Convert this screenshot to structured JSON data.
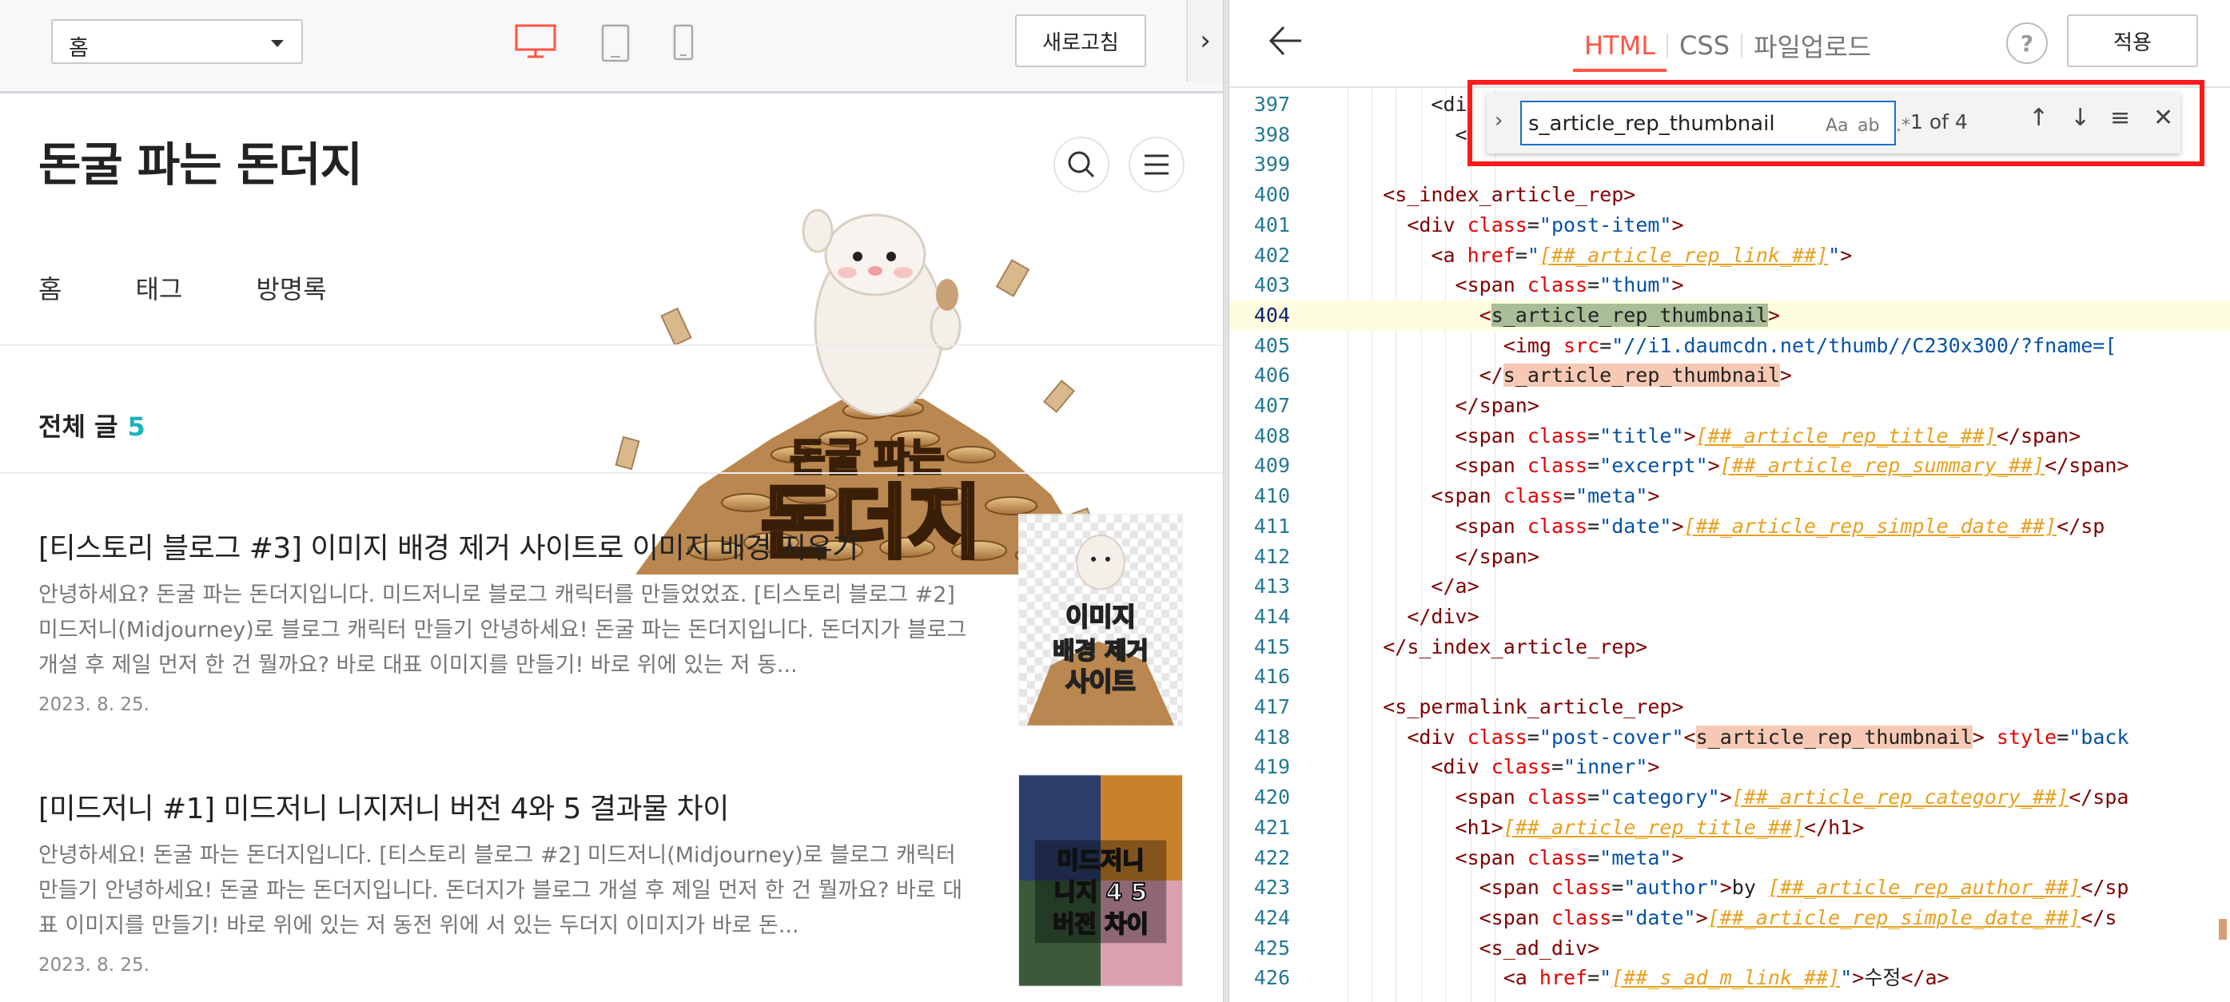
{
  "preview": {
    "page_select_value": "홈",
    "refresh_label": "새로고침",
    "collapse_glyph": "›",
    "devices": [
      "desktop",
      "tablet",
      "mobile"
    ]
  },
  "blog": {
    "title": "돈굴 파는 돈더지",
    "nav": [
      "홈",
      "태그",
      "방명록"
    ],
    "total_label": "전체 글",
    "total_count": "5",
    "mascot_line1": "돈굴 파는",
    "mascot_line2": "돈더지",
    "posts": [
      {
        "title": "[티스토리 블로그 #3] 이미지 배경 제거 사이트로 이미지 배경 지우기",
        "excerpt": "안녕하세요? 돈굴 파는 돈더지입니다. 미드저니로 블로그 캐릭터를 만들었었죠. [티스토리 블로그 #2] 미드저니(Midjourney)로 블로그 캐릭터 만들기 안녕하세요! 돈굴 파는 돈더지입니다. 돈더지가 블로그 개설 후 제일 먼저 한 건 뭘까요? 바로 대표 이미지를 만들기! 바로 위에 있는 저 동...",
        "date": "2023. 8. 25.",
        "thumb_text": [
          "이미지",
          "배경 제거",
          "사이트"
        ]
      },
      {
        "title": "[미드저니 #1] 미드저니 니지저니 버전 4와 5 결과물 차이",
        "excerpt": "안녕하세요! 돈굴 파는 돈더지입니다. [티스토리 블로그 #2] 미드저니(Midjourney)로 블로그 캐릭터 만들기 안녕하세요! 돈굴 파는 돈더지입니다. 돈더지가 블로그 개설 후 제일 먼저 한 건 뭘까요? 바로 대표 이미지를 만들기! 바로 위에 있는 저 동전 위에 서 있는 두더지 이미지가 바로 돈...",
        "date": "2023. 8. 25.",
        "thumb_text": [
          "미드저니",
          "니지 4 5",
          "버전 차이"
        ]
      }
    ]
  },
  "editor": {
    "tabs": [
      "HTML",
      "CSS",
      "파일업로드"
    ],
    "active_tab": "HTML",
    "help_label": "?",
    "apply_label": "적용",
    "find": {
      "query": "s_article_rep_thumbnail",
      "match_case": "Aa",
      "whole_word": "ab",
      "regex": ".*",
      "count": "1 of 4"
    },
    "lines": [
      {
        "n": "397",
        "segs": [
          [
            "t",
            "        <di"
          ]
        ]
      },
      {
        "n": "398",
        "segs": [
          [
            "t",
            "          <"
          ]
        ]
      },
      {
        "n": "399",
        "segs": [
          [
            "t",
            ""
          ]
        ]
      },
      {
        "n": "400",
        "segs": [
          [
            "t",
            "    "
          ],
          [
            "tag",
            "<s_index_article_rep>"
          ]
        ]
      },
      {
        "n": "401",
        "segs": [
          [
            "t",
            "      "
          ],
          [
            "tag",
            "<div"
          ],
          [
            "t",
            " "
          ],
          [
            "attr",
            "class"
          ],
          [
            "t",
            "="
          ],
          [
            "str",
            "\"post-item\""
          ],
          [
            "tag",
            ">"
          ]
        ]
      },
      {
        "n": "402",
        "segs": [
          [
            "t",
            "        "
          ],
          [
            "tag",
            "<a"
          ],
          [
            "t",
            " "
          ],
          [
            "attr",
            "href"
          ],
          [
            "t",
            "="
          ],
          [
            "str",
            "\""
          ],
          [
            "ph",
            "[##_article_rep_link_##]"
          ],
          [
            "str",
            "\""
          ],
          [
            "tag",
            ">"
          ]
        ]
      },
      {
        "n": "403",
        "segs": [
          [
            "t",
            "          "
          ],
          [
            "tag",
            "<span"
          ],
          [
            "t",
            " "
          ],
          [
            "attr",
            "class"
          ],
          [
            "t",
            "="
          ],
          [
            "str",
            "\"thum\""
          ],
          [
            "tag",
            ">"
          ]
        ]
      },
      {
        "n": "404",
        "segs": [
          [
            "t",
            "            "
          ],
          [
            "tag",
            "<"
          ],
          [
            "markcur",
            "s_article_rep_thumbnail"
          ],
          [
            "tag",
            ">"
          ]
        ],
        "current": true
      },
      {
        "n": "405",
        "segs": [
          [
            "t",
            "              "
          ],
          [
            "tag",
            "<img"
          ],
          [
            "t",
            " "
          ],
          [
            "attr",
            "src"
          ],
          [
            "t",
            "="
          ],
          [
            "str",
            "\"//i1.daumcdn.net/thumb//C230x300/?fname=["
          ]
        ]
      },
      {
        "n": "406",
        "segs": [
          [
            "t",
            "            "
          ],
          [
            "tag",
            "</"
          ],
          [
            "mark",
            "s_article_rep_thumbnail"
          ],
          [
            "tag",
            ">"
          ]
        ]
      },
      {
        "n": "407",
        "segs": [
          [
            "t",
            "          "
          ],
          [
            "tag",
            "</span>"
          ]
        ]
      },
      {
        "n": "408",
        "segs": [
          [
            "t",
            "          "
          ],
          [
            "tag",
            "<span"
          ],
          [
            "t",
            " "
          ],
          [
            "attr",
            "class"
          ],
          [
            "t",
            "="
          ],
          [
            "str",
            "\"title\""
          ],
          [
            "tag",
            ">"
          ],
          [
            "ph",
            "[##_article_rep_title_##]"
          ],
          [
            "tag",
            "</span>"
          ]
        ]
      },
      {
        "n": "409",
        "segs": [
          [
            "t",
            "          "
          ],
          [
            "tag",
            "<span"
          ],
          [
            "t",
            " "
          ],
          [
            "attr",
            "class"
          ],
          [
            "t",
            "="
          ],
          [
            "str",
            "\"excerpt\""
          ],
          [
            "tag",
            ">"
          ],
          [
            "ph",
            "[##_article_rep_summary_##]"
          ],
          [
            "tag",
            "</span>"
          ]
        ]
      },
      {
        "n": "410",
        "segs": [
          [
            "t",
            "        "
          ],
          [
            "tag",
            "<span"
          ],
          [
            "t",
            " "
          ],
          [
            "attr",
            "class"
          ],
          [
            "t",
            "="
          ],
          [
            "str",
            "\"meta\""
          ],
          [
            "tag",
            ">"
          ]
        ]
      },
      {
        "n": "411",
        "segs": [
          [
            "t",
            "          "
          ],
          [
            "tag",
            "<span"
          ],
          [
            "t",
            " "
          ],
          [
            "attr",
            "class"
          ],
          [
            "t",
            "="
          ],
          [
            "str",
            "\"date\""
          ],
          [
            "tag",
            ">"
          ],
          [
            "ph",
            "[##_article_rep_simple_date_##]"
          ],
          [
            "tag",
            "</sp"
          ]
        ]
      },
      {
        "n": "412",
        "segs": [
          [
            "t",
            "          "
          ],
          [
            "tag",
            "</span>"
          ]
        ]
      },
      {
        "n": "413",
        "segs": [
          [
            "t",
            "        "
          ],
          [
            "tag",
            "</a>"
          ]
        ]
      },
      {
        "n": "414",
        "segs": [
          [
            "t",
            "      "
          ],
          [
            "tag",
            "</div>"
          ]
        ]
      },
      {
        "n": "415",
        "segs": [
          [
            "t",
            "    "
          ],
          [
            "tag",
            "</s_index_article_rep>"
          ]
        ]
      },
      {
        "n": "416",
        "segs": [
          [
            "t",
            ""
          ]
        ]
      },
      {
        "n": "417",
        "segs": [
          [
            "t",
            "    "
          ],
          [
            "tag",
            "<s_permalink_article_rep>"
          ]
        ]
      },
      {
        "n": "418",
        "segs": [
          [
            "t",
            "      "
          ],
          [
            "tag",
            "<div"
          ],
          [
            "t",
            " "
          ],
          [
            "attr",
            "class"
          ],
          [
            "t",
            "="
          ],
          [
            "str",
            "\"post-cover\""
          ],
          [
            "tag",
            "<"
          ],
          [
            "mark",
            "s_article_rep_thumbnail"
          ],
          [
            "tag",
            ">"
          ],
          [
            "t",
            " "
          ],
          [
            "attr",
            "style"
          ],
          [
            "t",
            "="
          ],
          [
            "str",
            "\"back"
          ]
        ]
      },
      {
        "n": "419",
        "segs": [
          [
            "t",
            "        "
          ],
          [
            "tag",
            "<div"
          ],
          [
            "t",
            " "
          ],
          [
            "attr",
            "class"
          ],
          [
            "t",
            "="
          ],
          [
            "str",
            "\"inner\""
          ],
          [
            "tag",
            ">"
          ]
        ]
      },
      {
        "n": "420",
        "segs": [
          [
            "t",
            "          "
          ],
          [
            "tag",
            "<span"
          ],
          [
            "t",
            " "
          ],
          [
            "attr",
            "class"
          ],
          [
            "t",
            "="
          ],
          [
            "str",
            "\"category\""
          ],
          [
            "tag",
            ">"
          ],
          [
            "ph",
            "[##_article_rep_category_##]"
          ],
          [
            "tag",
            "</spa"
          ]
        ]
      },
      {
        "n": "421",
        "segs": [
          [
            "t",
            "          "
          ],
          [
            "tag",
            "<h1>"
          ],
          [
            "ph",
            "[##_article_rep_title_##]"
          ],
          [
            "tag",
            "</h1>"
          ]
        ]
      },
      {
        "n": "422",
        "segs": [
          [
            "t",
            "          "
          ],
          [
            "tag",
            "<span"
          ],
          [
            "t",
            " "
          ],
          [
            "attr",
            "class"
          ],
          [
            "t",
            "="
          ],
          [
            "str",
            "\"meta\""
          ],
          [
            "tag",
            ">"
          ]
        ]
      },
      {
        "n": "423",
        "segs": [
          [
            "t",
            "            "
          ],
          [
            "tag",
            "<span"
          ],
          [
            "t",
            " "
          ],
          [
            "attr",
            "class"
          ],
          [
            "t",
            "="
          ],
          [
            "str",
            "\"author\""
          ],
          [
            "tag",
            ">"
          ],
          [
            "t",
            "by "
          ],
          [
            "ph",
            "[##_article_rep_author_##]"
          ],
          [
            "tag",
            "</sp"
          ]
        ]
      },
      {
        "n": "424",
        "segs": [
          [
            "t",
            "            "
          ],
          [
            "tag",
            "<span"
          ],
          [
            "t",
            " "
          ],
          [
            "attr",
            "class"
          ],
          [
            "t",
            "="
          ],
          [
            "str",
            "\"date\""
          ],
          [
            "tag",
            ">"
          ],
          [
            "ph",
            "[##_article_rep_simple_date_##]"
          ],
          [
            "tag",
            "</s"
          ]
        ]
      },
      {
        "n": "425",
        "segs": [
          [
            "t",
            "            "
          ],
          [
            "tag",
            "<s_ad_div>"
          ]
        ]
      },
      {
        "n": "426",
        "segs": [
          [
            "t",
            "              "
          ],
          [
            "tag",
            "<a"
          ],
          [
            "t",
            " "
          ],
          [
            "attr",
            "href"
          ],
          [
            "t",
            "="
          ],
          [
            "str",
            "\""
          ],
          [
            "ph",
            "[##_s_ad_m_link_##]"
          ],
          [
            "str",
            "\""
          ],
          [
            "tag",
            ">"
          ],
          [
            "t",
            "수정"
          ],
          [
            "tag",
            "</a>"
          ]
        ]
      }
    ]
  }
}
